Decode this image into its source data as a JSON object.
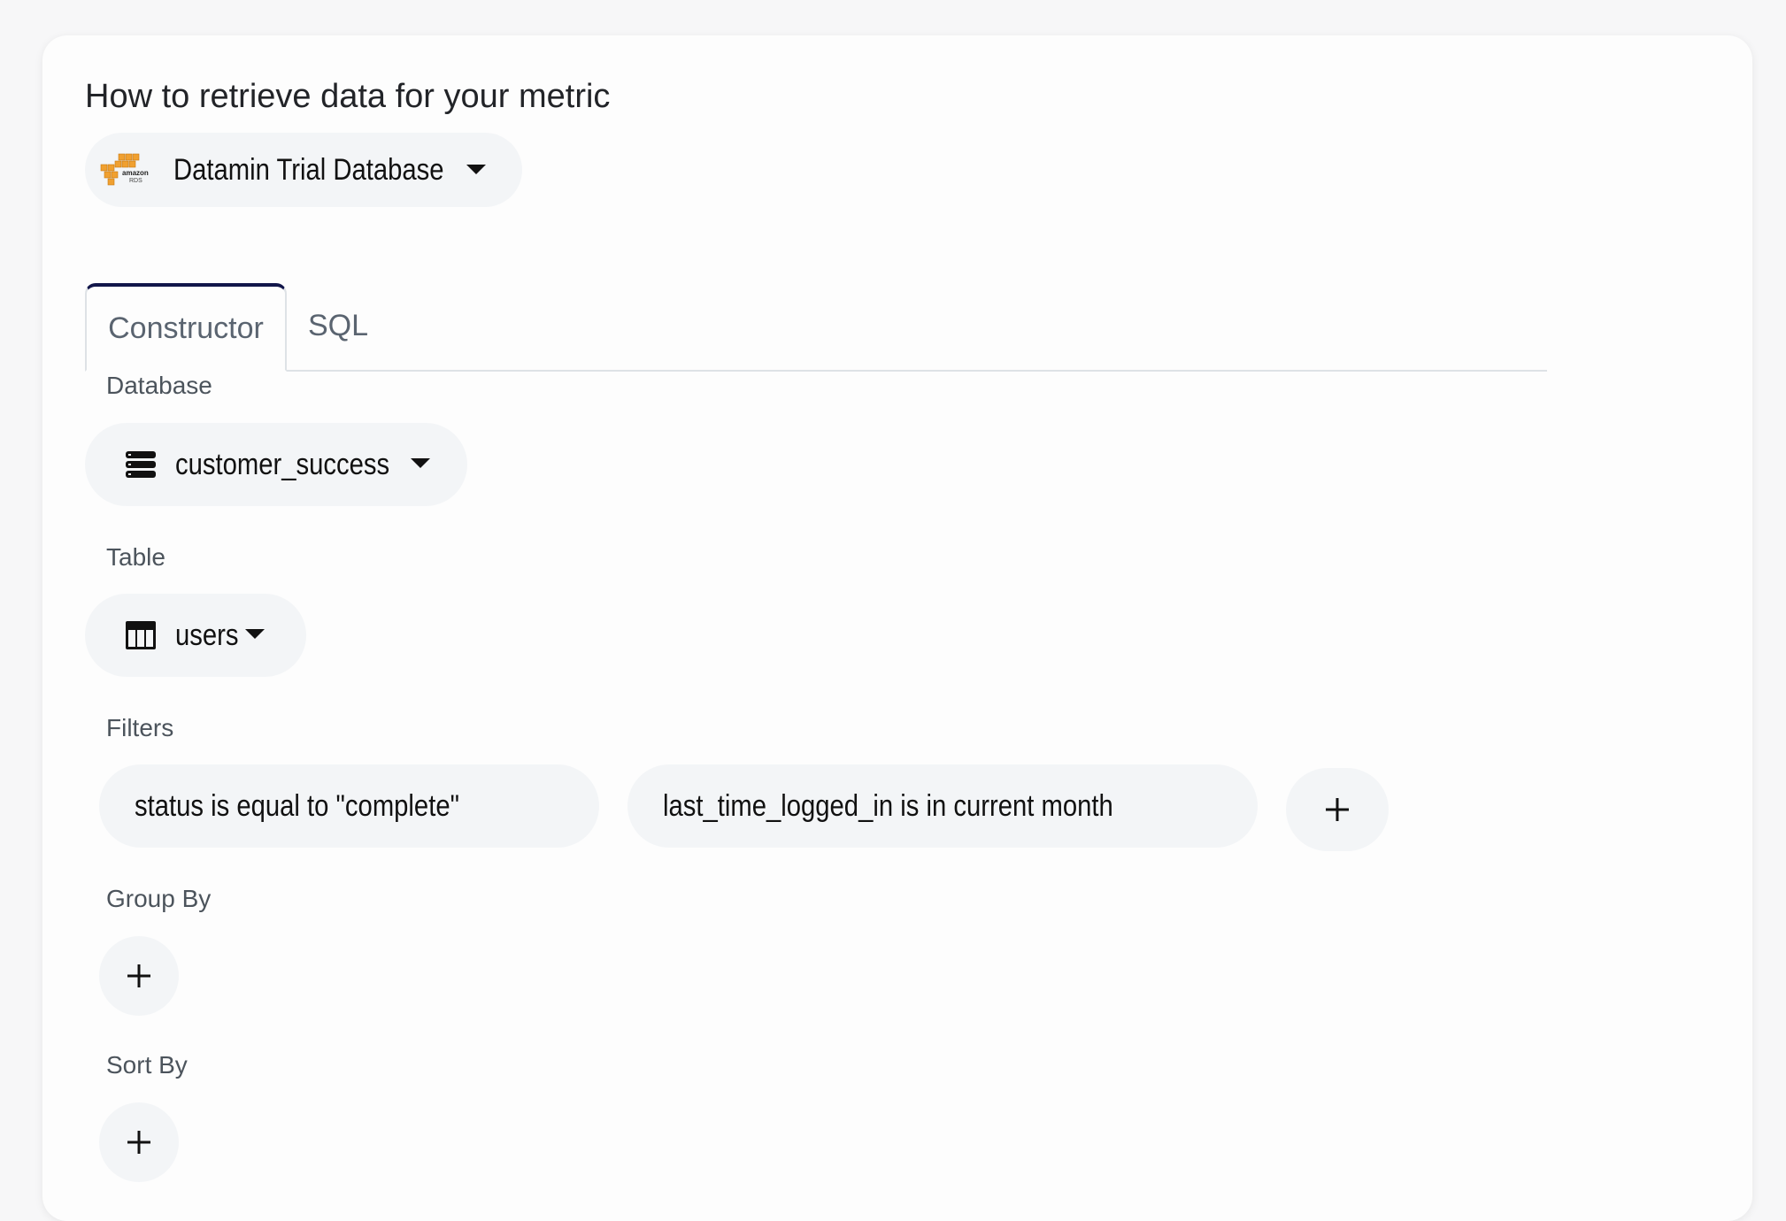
{
  "header": {
    "title": "How to retrieve data for your metric"
  },
  "datasource": {
    "label": "Datamin Trial Database",
    "logo_text_top": "amazon",
    "logo_text_bottom": "RDS"
  },
  "tabs": [
    {
      "label": "Constructor",
      "active": true
    },
    {
      "label": "SQL",
      "active": false
    }
  ],
  "database": {
    "label": "Database",
    "value": "customer_success",
    "icon": "database-icon"
  },
  "table": {
    "label": "Table",
    "value": "users",
    "icon": "table-icon"
  },
  "filters": {
    "label": "Filters",
    "items": [
      "status is equal to \"complete\"",
      "last_time_logged_in is in current month"
    ],
    "add_icon": "plus-icon"
  },
  "group_by": {
    "label": "Group By",
    "add_icon": "plus-icon"
  },
  "sort_by": {
    "label": "Sort By",
    "add_icon": "plus-icon"
  },
  "colors": {
    "accent_tab_border": "#12164a",
    "pill_background": "#f3f5f7",
    "rds_orange": "#f0a030"
  }
}
